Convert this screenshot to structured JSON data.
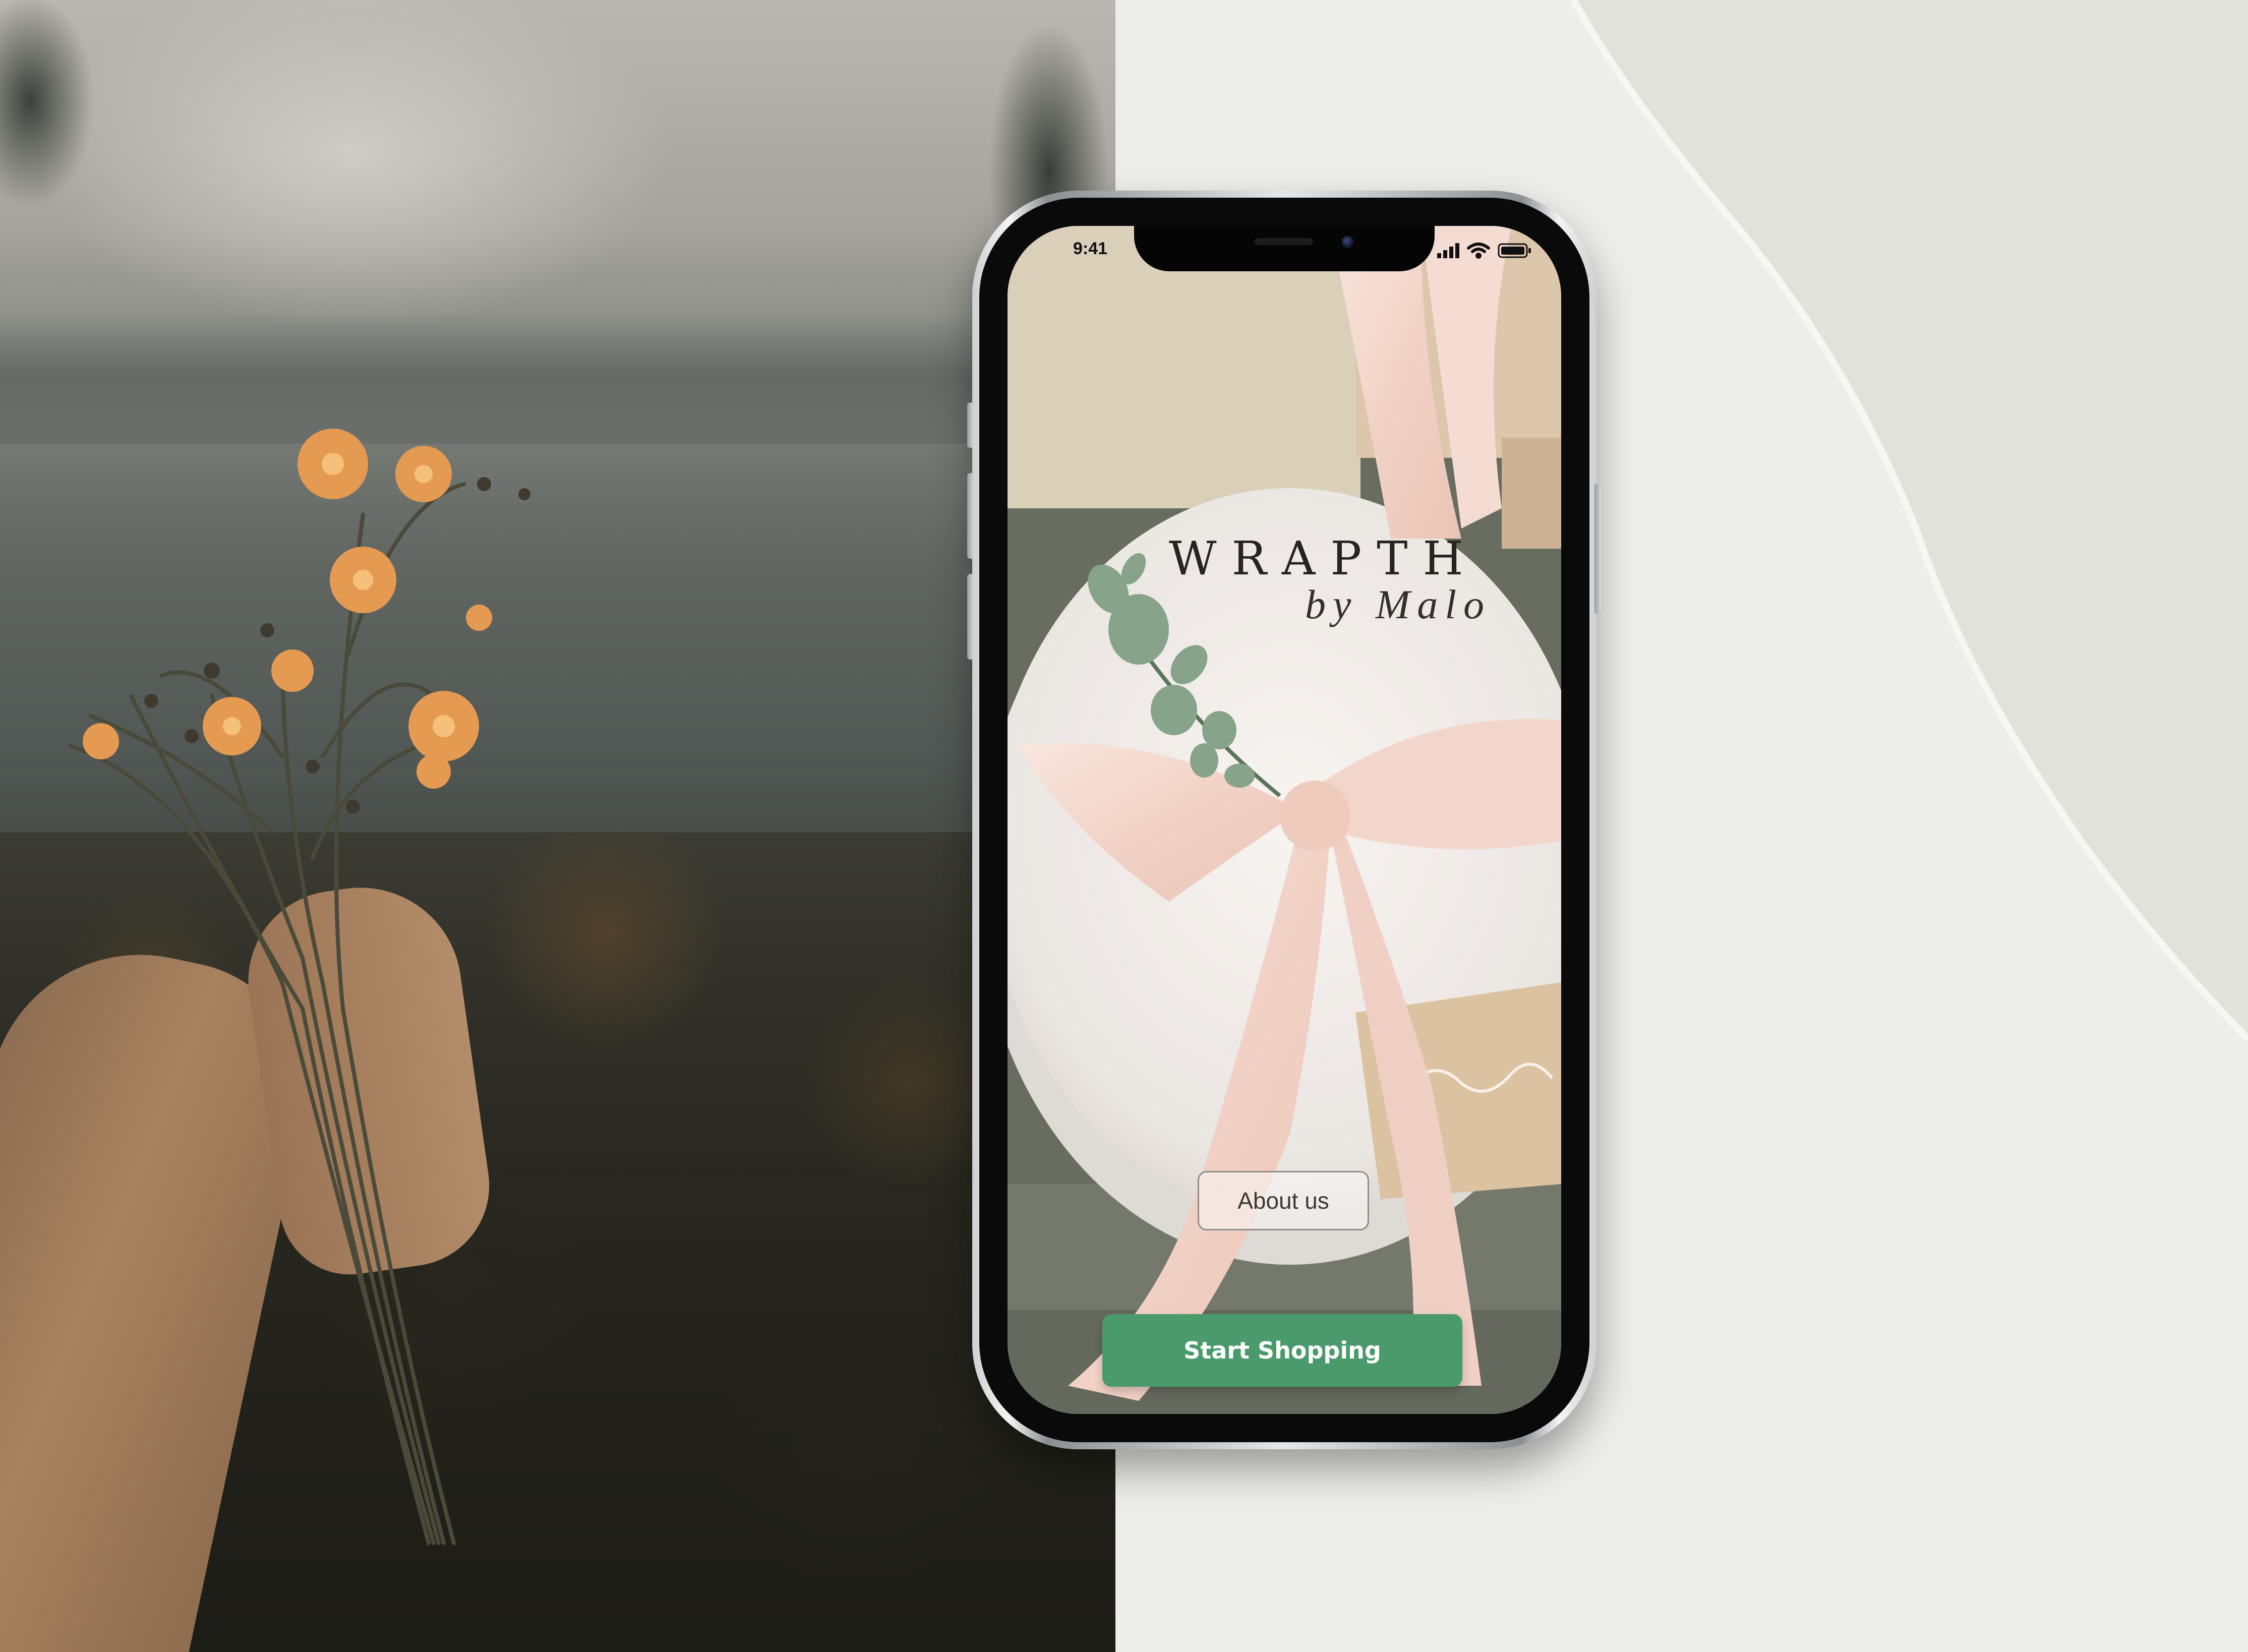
{
  "status_bar": {
    "time": "9:41",
    "signal_icon": "cellular-signal-icon",
    "wifi_icon": "wifi-icon",
    "battery_icon": "battery-icon"
  },
  "brand": {
    "title": "WRAPTH",
    "subtitle": "by Malo"
  },
  "actions": {
    "about_label": "About us",
    "shop_label": "Start Shopping"
  },
  "colors": {
    "primary_button": "#4b9a6c",
    "ribbon": "#f3d9cf",
    "background_light": "#ededea"
  }
}
